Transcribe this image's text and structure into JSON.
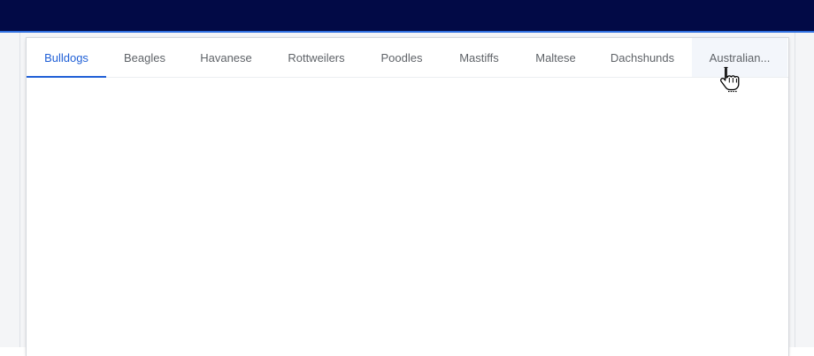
{
  "tabs": [
    {
      "label": "Bulldogs",
      "active": true
    },
    {
      "label": "Beagles",
      "active": false
    },
    {
      "label": "Havanese",
      "active": false
    },
    {
      "label": "Rottweilers",
      "active": false
    },
    {
      "label": "Poodles",
      "active": false
    },
    {
      "label": "Mastiffs",
      "active": false
    },
    {
      "label": "Maltese",
      "active": false
    },
    {
      "label": "Dachshunds",
      "active": false
    },
    {
      "label": "Australian...",
      "active": false,
      "hovered": true
    }
  ],
  "colors": {
    "topbar": "#020a46",
    "accent": "#1f5fd6",
    "tab_text": "#5f6368",
    "hover_bg": "#f3f6fb"
  },
  "cursor": {
    "icon": "hand-pointer-icon"
  }
}
